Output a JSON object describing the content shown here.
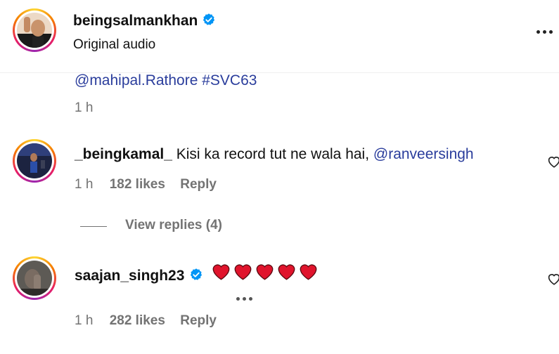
{
  "post": {
    "username": "beingsalmankhan",
    "audio": "Original audio"
  },
  "caption": {
    "text": "@mahipal.Rathore #SVC63",
    "time": "1 h"
  },
  "comments": [
    {
      "username": "_beingkamal_",
      "text_prefix": "Kisi ka record tut ne wala hai, ",
      "mention": "@ranveersingh",
      "time": "1 h",
      "likes": "182 likes",
      "reply": "Reply",
      "view_replies": "View replies (4)"
    },
    {
      "username": "saajan_singh23",
      "hearts": 5,
      "time": "1 h",
      "likes": "282 likes",
      "reply": "Reply"
    }
  ],
  "colors": {
    "link": "#2a3d9c",
    "verified": "#0095f6",
    "heart": "#e0142c",
    "muted": "#737373"
  }
}
